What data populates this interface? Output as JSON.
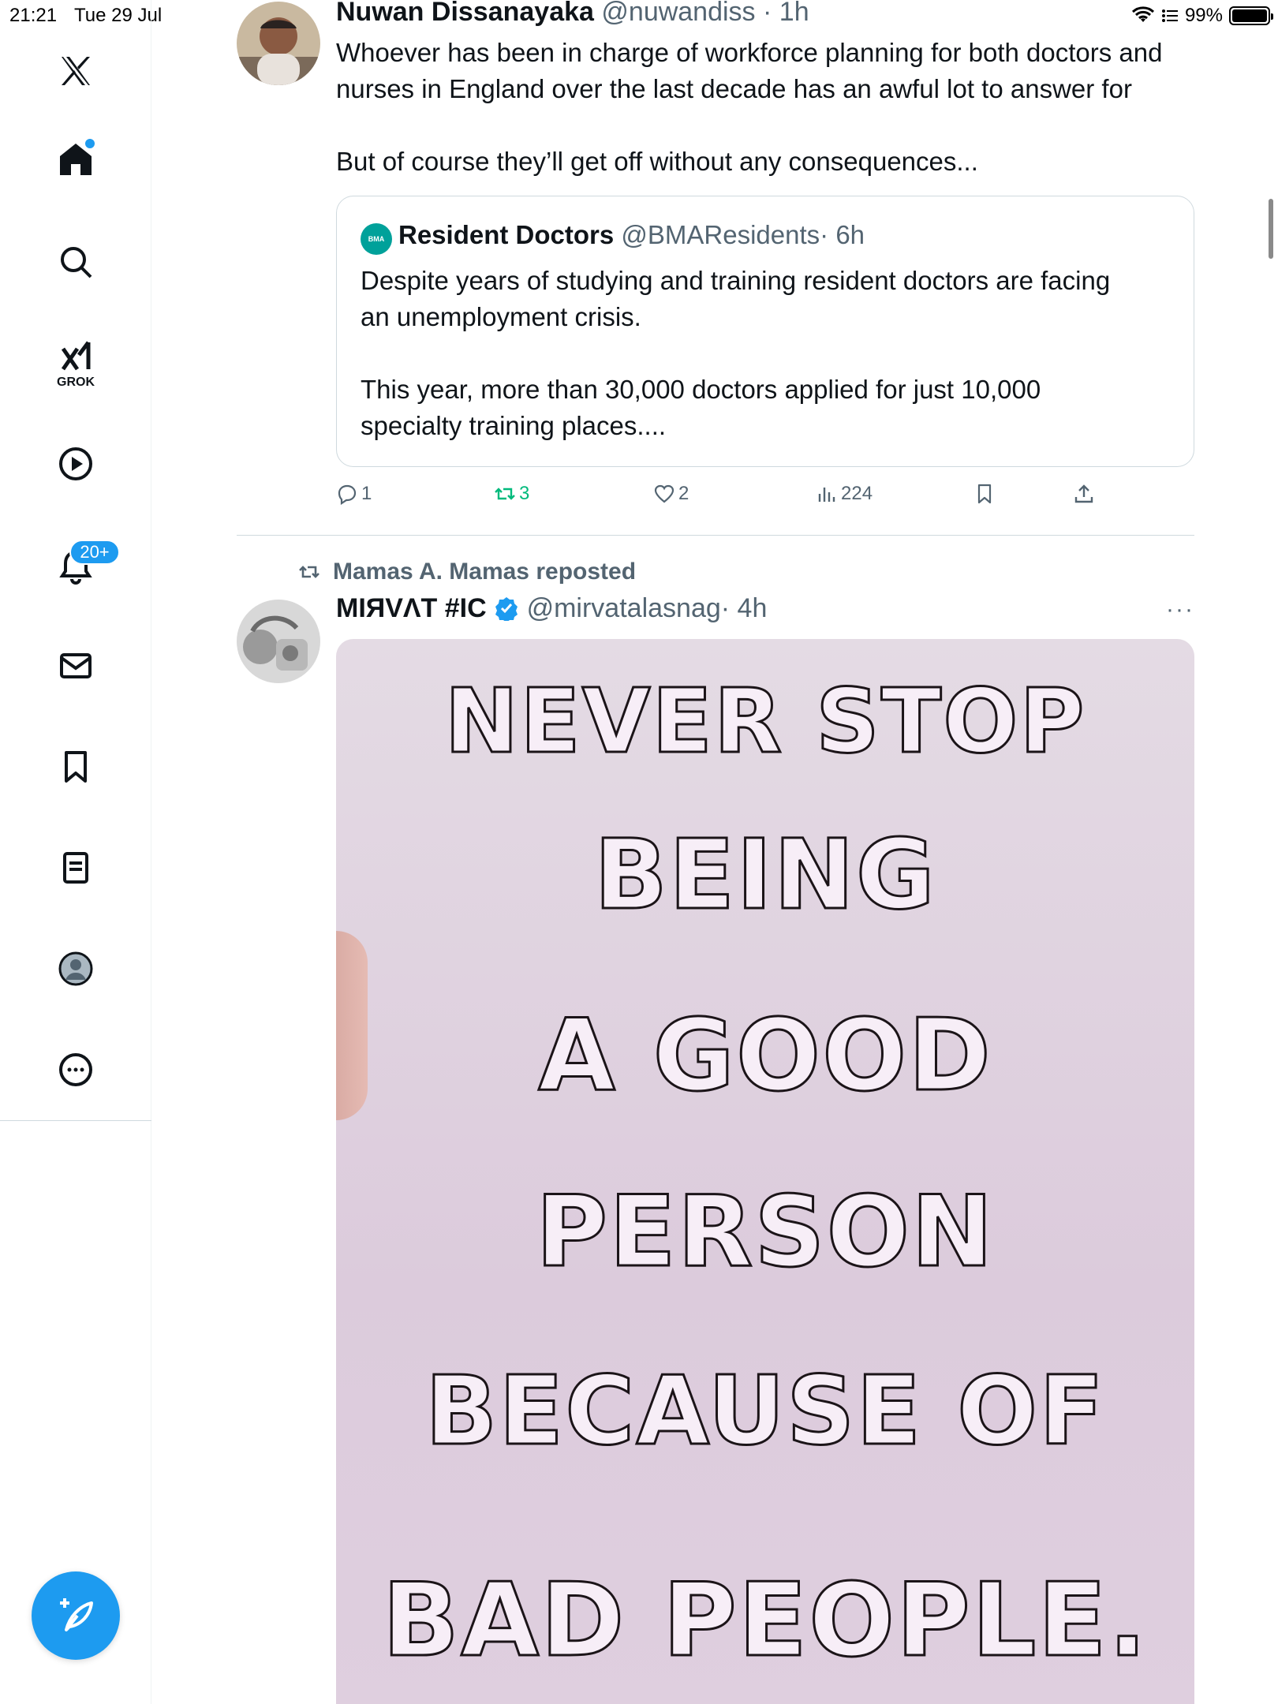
{
  "status_bar": {
    "time": "21:21",
    "date": "Tue 29 Jul",
    "battery": "99%"
  },
  "sidebar": {
    "items": [
      {
        "icon": "x-logo-icon"
      },
      {
        "icon": "home-icon"
      },
      {
        "icon": "search-icon"
      },
      {
        "icon": "grok-icon",
        "label": "GROK"
      },
      {
        "icon": "video-icon"
      },
      {
        "icon": "bell-icon",
        "badge": "20+"
      },
      {
        "icon": "mail-icon"
      },
      {
        "icon": "bookmark-icon"
      },
      {
        "icon": "list-icon"
      },
      {
        "icon": "profile-icon"
      },
      {
        "icon": "more-icon"
      }
    ],
    "compose_icon": "compose-icon",
    "accent": "#1d9bf0"
  },
  "tweet1": {
    "name": "Nuwan Dissanayaka",
    "handle": "@nuwandiss",
    "time": "· 1h",
    "body_line1": "Whoever has been in charge of workforce planning for both doctors and",
    "body_line2": "nurses in England over the last decade has an awful lot to answer for",
    "body_line3": "But of course they’ll get off without any consequences...",
    "quote": {
      "avatar_text": "BMA",
      "name": "Resident Doctors",
      "handle": "@BMAResidents",
      "time": "· 6h",
      "line1": "Despite years of studying and training resident doctors are facing",
      "line2": "an unemployment crisis.",
      "line3": "This year, more than 30,000 doctors applied for just 10,000",
      "line4": "specialty training places...."
    },
    "actions": {
      "replies": "1",
      "reposts": "3",
      "likes": "2",
      "views": "224"
    }
  },
  "tweet2": {
    "repost_label": "Mamas A. Mamas reposted",
    "name": "MIЯVΛT #IC",
    "handle": "@mirvatalasnag",
    "time": "· 4h",
    "more": "···",
    "image_text": [
      "NEVER STOP",
      "BEING",
      "A GOOD",
      "PERSON",
      "BECAUSE OF",
      "BAD PEOPLE."
    ]
  }
}
